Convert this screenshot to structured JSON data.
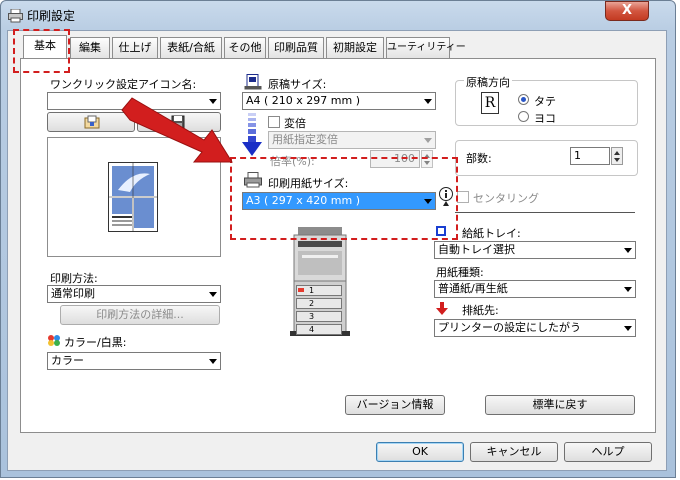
{
  "window": {
    "title": "印刷設定",
    "close_glyph": "X"
  },
  "tabs": [
    "基本",
    "編集",
    "仕上げ",
    "表紙/合紙",
    "その他",
    "印刷品質",
    "初期設定",
    "ユーティリティー"
  ],
  "one_click": {
    "label": "ワンクリック設定アイコン名:",
    "value": ""
  },
  "original": {
    "size_label": "原稿サイズ:",
    "size_value": "A4 ( 210 x 297 mm )",
    "scale_checkbox": "変倍",
    "scale_mode": "用紙指定変倍",
    "ratio_label": "倍率(%):",
    "ratio_value": "100"
  },
  "orientation": {
    "title": "原稿方向",
    "glyph": "R",
    "options": [
      "タテ",
      "ヨコ"
    ],
    "selected": "タテ"
  },
  "copies": {
    "label": "部数:",
    "value": "1"
  },
  "paper": {
    "label": "印刷用紙サイズ:",
    "value": "A3 ( 297 x 420 mm )",
    "centering": "センタリング"
  },
  "tray": {
    "label": "給紙トレイ:",
    "value": "自動トレイ選択"
  },
  "media": {
    "label": "用紙種類:",
    "value": "普通紙/再生紙"
  },
  "output": {
    "label": "排紙先:",
    "value": "プリンターの設定にしたがう"
  },
  "print_method": {
    "label": "印刷方法:",
    "value": "通常印刷",
    "details_button": "印刷方法の詳細..."
  },
  "color_mode": {
    "label": "カラー/白黒:",
    "value": "カラー"
  },
  "printer_trays": [
    "1",
    "2",
    "3",
    "4"
  ],
  "buttons": {
    "version": "バージョン情報",
    "reset": "標準に戻す",
    "ok": "OK",
    "cancel": "キャンセル",
    "help": "ヘルプ"
  },
  "colors": {
    "highlight": "#d21e1e",
    "selection": "#3399ff",
    "accent_blue": "#1a3fd1"
  }
}
